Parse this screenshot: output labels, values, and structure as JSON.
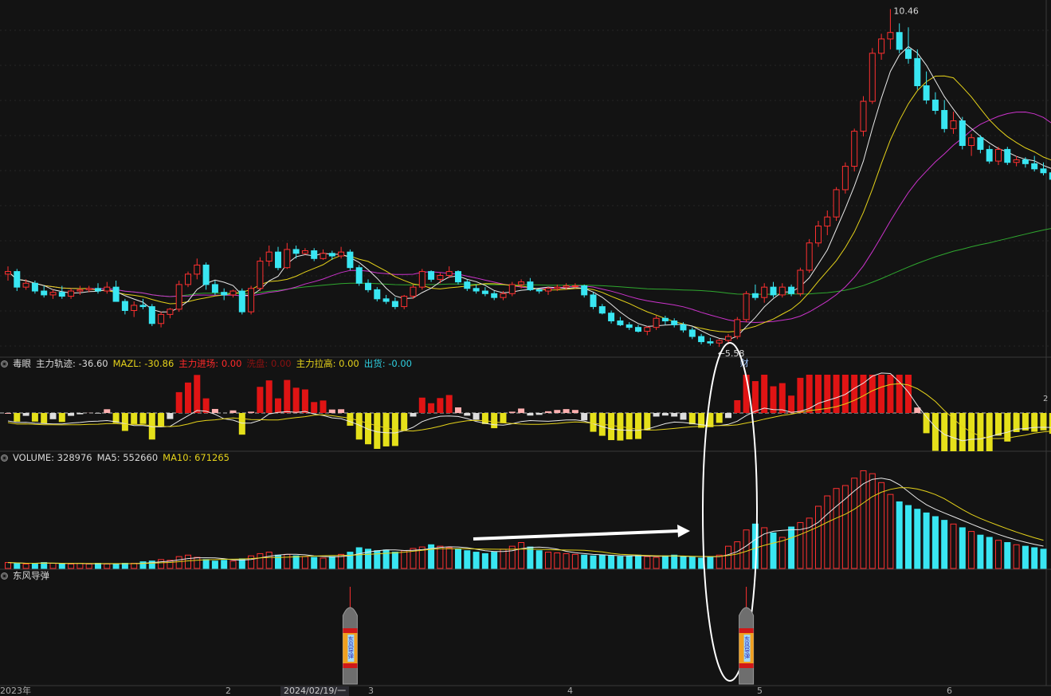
{
  "chart_data": {
    "type": "candlestick",
    "main": {
      "high_label": "10.46",
      "low_label": "←5.58",
      "event_tag": "财",
      "ylim": [
        5.2,
        10.6
      ]
    },
    "indicator": {
      "name": "毒眼",
      "labels": [
        {
          "text": "主力轨迹: -36.60",
          "color": "#d8d8d8"
        },
        {
          "text": "MAZL: -30.86",
          "color": "#e5d21a"
        },
        {
          "text": "主力进场: 0.00",
          "color": "#ff2a2a"
        },
        {
          "text": "洗盘: 0.00",
          "color": "#8a1111"
        },
        {
          "text": "主力拉高: 0.00",
          "color": "#e5d21a"
        },
        {
          "text": "出货: -0.00",
          "color": "#2ecfe0"
        }
      ],
      "right_label": "2"
    },
    "volume": {
      "labels": [
        {
          "text": "VOLUME: 328976",
          "color": "#d8d8d8"
        },
        {
          "text": "MA5: 552660",
          "color": "#d8d8d8"
        },
        {
          "text": "MA10: 671265",
          "color": "#e5d21a"
        }
      ]
    },
    "signal": {
      "name": "东风导弹",
      "missile_text": "东风导弹",
      "marks_at_bar": [
        38,
        82
      ]
    },
    "x_axis": {
      "labels": [
        "2023年",
        "2",
        "2024/02/19/一",
        "3",
        "4",
        "5",
        "6"
      ]
    },
    "candles": [
      [
        6.38,
        6.5,
        6.28,
        6.42
      ],
      [
        6.42,
        6.46,
        6.12,
        6.18
      ],
      [
        6.18,
        6.3,
        6.14,
        6.24
      ],
      [
        6.24,
        6.28,
        6.08,
        6.12
      ],
      [
        6.12,
        6.2,
        6.02,
        6.06
      ],
      [
        6.06,
        6.14,
        6.0,
        6.1
      ],
      [
        6.1,
        6.2,
        6.0,
        6.04
      ],
      [
        6.04,
        6.16,
        6.0,
        6.12
      ],
      [
        6.12,
        6.2,
        6.06,
        6.14
      ],
      [
        6.14,
        6.2,
        6.1,
        6.16
      ],
      [
        6.16,
        6.24,
        6.08,
        6.12
      ],
      [
        6.12,
        6.26,
        6.08,
        6.18
      ],
      [
        6.18,
        6.28,
        6.02,
        5.96
      ],
      [
        5.96,
        6.0,
        5.76,
        5.82
      ],
      [
        5.82,
        5.96,
        5.72,
        5.9
      ],
      [
        5.9,
        6.0,
        5.84,
        5.88
      ],
      [
        5.88,
        5.92,
        5.58,
        5.62
      ],
      [
        5.62,
        5.8,
        5.56,
        5.76
      ],
      [
        5.76,
        5.86,
        5.7,
        5.84
      ],
      [
        5.84,
        6.28,
        5.8,
        6.22
      ],
      [
        6.22,
        6.42,
        6.18,
        6.38
      ],
      [
        6.38,
        6.62,
        6.3,
        6.52
      ],
      [
        6.52,
        6.56,
        6.14,
        6.22
      ],
      [
        6.22,
        6.28,
        6.06,
        6.1
      ],
      [
        6.1,
        6.16,
        5.98,
        6.06
      ],
      [
        6.06,
        6.14,
        6.02,
        6.12
      ],
      [
        6.12,
        6.16,
        5.76,
        5.8
      ],
      [
        5.8,
        6.2,
        5.76,
        6.16
      ],
      [
        6.16,
        6.64,
        6.12,
        6.58
      ],
      [
        6.58,
        6.82,
        6.5,
        6.72
      ],
      [
        6.72,
        6.8,
        6.44,
        6.48
      ],
      [
        6.48,
        6.86,
        6.46,
        6.76
      ],
      [
        6.76,
        6.82,
        6.62,
        6.7
      ],
      [
        6.7,
        6.78,
        6.68,
        6.74
      ],
      [
        6.74,
        6.78,
        6.58,
        6.62
      ],
      [
        6.62,
        6.76,
        6.6,
        6.7
      ],
      [
        6.7,
        6.74,
        6.6,
        6.66
      ],
      [
        6.66,
        6.8,
        6.62,
        6.72
      ],
      [
        6.72,
        6.76,
        6.44,
        6.48
      ],
      [
        6.48,
        6.52,
        6.2,
        6.24
      ],
      [
        6.24,
        6.3,
        6.1,
        6.14
      ],
      [
        6.14,
        6.18,
        5.96,
        6.0
      ],
      [
        6.0,
        6.06,
        5.92,
        5.96
      ],
      [
        5.96,
        6.02,
        5.84,
        5.88
      ],
      [
        5.88,
        6.06,
        5.84,
        6.04
      ],
      [
        6.04,
        6.22,
        6.0,
        6.18
      ],
      [
        6.18,
        6.46,
        6.14,
        6.42
      ],
      [
        6.42,
        6.44,
        6.26,
        6.3
      ],
      [
        6.3,
        6.4,
        6.24,
        6.36
      ],
      [
        6.36,
        6.5,
        6.32,
        6.42
      ],
      [
        6.42,
        6.44,
        6.22,
        6.26
      ],
      [
        6.26,
        6.3,
        6.12,
        6.16
      ],
      [
        6.16,
        6.22,
        6.08,
        6.12
      ],
      [
        6.12,
        6.18,
        6.04,
        6.08
      ],
      [
        6.08,
        6.12,
        5.98,
        6.02
      ],
      [
        6.02,
        6.12,
        5.98,
        6.08
      ],
      [
        6.08,
        6.26,
        6.04,
        6.22
      ],
      [
        6.22,
        6.3,
        6.16,
        6.26
      ],
      [
        6.26,
        6.32,
        6.12,
        6.14
      ],
      [
        6.14,
        6.16,
        6.08,
        6.12
      ],
      [
        6.12,
        6.18,
        6.06,
        6.16
      ],
      [
        6.16,
        6.22,
        6.12,
        6.18
      ],
      [
        6.18,
        6.24,
        6.14,
        6.2
      ],
      [
        6.2,
        6.24,
        6.16,
        6.2
      ],
      [
        6.2,
        6.22,
        6.02,
        6.06
      ],
      [
        6.06,
        6.1,
        5.84,
        5.88
      ],
      [
        5.88,
        5.92,
        5.76,
        5.78
      ],
      [
        5.78,
        5.82,
        5.62,
        5.66
      ],
      [
        5.66,
        5.72,
        5.58,
        5.6
      ],
      [
        5.6,
        5.64,
        5.52,
        5.56
      ],
      [
        5.56,
        5.6,
        5.48,
        5.5
      ],
      [
        5.5,
        5.58,
        5.44,
        5.56
      ],
      [
        5.56,
        5.74,
        5.52,
        5.7
      ],
      [
        5.7,
        5.74,
        5.6,
        5.66
      ],
      [
        5.66,
        5.7,
        5.56,
        5.6
      ],
      [
        5.6,
        5.64,
        5.48,
        5.52
      ],
      [
        5.52,
        5.56,
        5.38,
        5.42
      ],
      [
        5.42,
        5.46,
        5.3,
        5.34
      ],
      [
        5.34,
        5.4,
        5.28,
        5.32
      ],
      [
        5.32,
        5.38,
        5.26,
        5.36
      ],
      [
        5.36,
        5.46,
        5.3,
        5.42
      ],
      [
        5.42,
        5.72,
        5.38,
        5.68
      ],
      [
        5.68,
        6.12,
        5.64,
        6.08
      ],
      [
        6.08,
        6.22,
        5.98,
        6.02
      ],
      [
        6.02,
        6.24,
        5.94,
        6.18
      ],
      [
        6.18,
        6.26,
        6.02,
        6.06
      ],
      [
        6.06,
        6.24,
        6.02,
        6.18
      ],
      [
        6.18,
        6.22,
        6.04,
        6.08
      ],
      [
        6.08,
        6.48,
        6.04,
        6.44
      ],
      [
        6.44,
        6.92,
        6.4,
        6.86
      ],
      [
        6.86,
        7.2,
        6.8,
        7.12
      ],
      [
        7.12,
        7.36,
        6.98,
        7.26
      ],
      [
        7.26,
        7.72,
        7.2,
        7.68
      ],
      [
        7.68,
        8.1,
        7.62,
        8.04
      ],
      [
        8.04,
        8.62,
        7.96,
        8.58
      ],
      [
        8.58,
        9.12,
        8.5,
        9.04
      ],
      [
        9.04,
        9.86,
        9.0,
        9.78
      ],
      [
        9.78,
        10.08,
        9.68,
        10.0
      ],
      [
        10.0,
        10.46,
        9.84,
        10.1
      ],
      [
        10.1,
        10.24,
        9.78,
        9.84
      ],
      [
        9.84,
        10.18,
        9.62,
        9.7
      ],
      [
        9.7,
        9.84,
        9.22,
        9.28
      ],
      [
        9.28,
        9.5,
        9.0,
        9.06
      ],
      [
        9.06,
        9.18,
        8.84,
        8.9
      ],
      [
        8.9,
        9.06,
        8.56,
        8.62
      ],
      [
        8.62,
        8.88,
        8.54,
        8.74
      ],
      [
        8.74,
        8.8,
        8.3,
        8.36
      ],
      [
        8.36,
        8.54,
        8.2,
        8.48
      ],
      [
        8.48,
        8.52,
        8.24,
        8.3
      ],
      [
        8.3,
        8.36,
        8.08,
        8.12
      ],
      [
        8.12,
        8.34,
        8.06,
        8.3
      ],
      [
        8.3,
        8.34,
        8.06,
        8.1
      ],
      [
        8.1,
        8.2,
        8.04,
        8.14
      ],
      [
        8.14,
        8.18,
        8.02,
        8.08
      ],
      [
        8.08,
        8.2,
        7.96,
        8.0
      ],
      [
        8.0,
        8.1,
        7.9,
        7.94
      ],
      [
        7.94,
        8.0,
        7.8,
        7.84
      ]
    ],
    "volumes": [
      8,
      7,
      6,
      7,
      8,
      7,
      6,
      6,
      7,
      6,
      7,
      6,
      6,
      7,
      7,
      9,
      10,
      12,
      11,
      16,
      18,
      15,
      12,
      10,
      11,
      10,
      13,
      17,
      20,
      22,
      18,
      19,
      17,
      16,
      15,
      14,
      16,
      19,
      22,
      28,
      26,
      24,
      25,
      22,
      24,
      27,
      29,
      32,
      30,
      28,
      26,
      24,
      22,
      20,
      22,
      26,
      30,
      35,
      29,
      24,
      22,
      21,
      20,
      19,
      18,
      17,
      18,
      17,
      16,
      17,
      18,
      16,
      15,
      17,
      18,
      16,
      15,
      14,
      16,
      18,
      30,
      36,
      52,
      60,
      55,
      48,
      42,
      56,
      62,
      68,
      84,
      98,
      108,
      112,
      122,
      132,
      128,
      116,
      100,
      90,
      85,
      80,
      75,
      70,
      65,
      60,
      55,
      50,
      45,
      42,
      38,
      35,
      32,
      30,
      28,
      26
    ],
    "colors": {
      "up": "#ff3030",
      "down": "#39e6f2",
      "ma5": "#e8e8e8",
      "ma10": "#e5d21a",
      "ma20": "#cc33cc",
      "ma60": "#2fa82f"
    }
  }
}
